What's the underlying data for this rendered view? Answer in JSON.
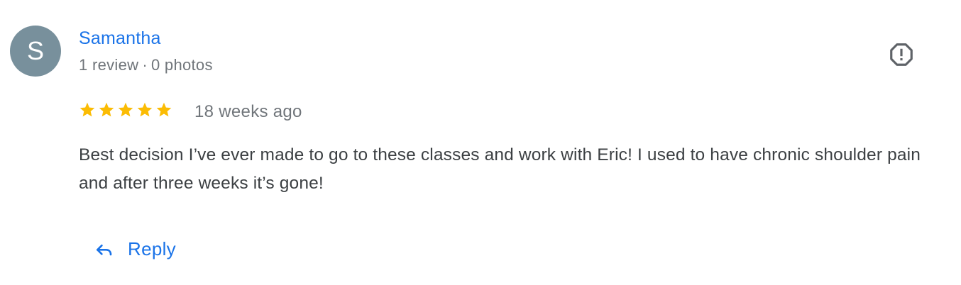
{
  "review": {
    "avatar_initial": "S",
    "reviewer_name": "Samantha",
    "review_count": "1 review",
    "meta_separator": "·",
    "photo_count": "0 photos",
    "rating": 5,
    "max_rating": 5,
    "date": "18 weeks ago",
    "text": "Best decision I’ve ever made to go to these classes and work with Eric! I used to have chronic shoulder pain and after three weeks it’s gone!",
    "reply_label": "Reply"
  },
  "icons": {
    "flag": "report-flag-icon",
    "reply": "reply-arrow-icon",
    "star": "star-icon"
  },
  "colors": {
    "link_blue": "#1a73e8",
    "star_gold": "#fbbc04",
    "avatar_bg": "#78909c",
    "meta_gray": "#70757a",
    "body_text": "#3c4043"
  }
}
